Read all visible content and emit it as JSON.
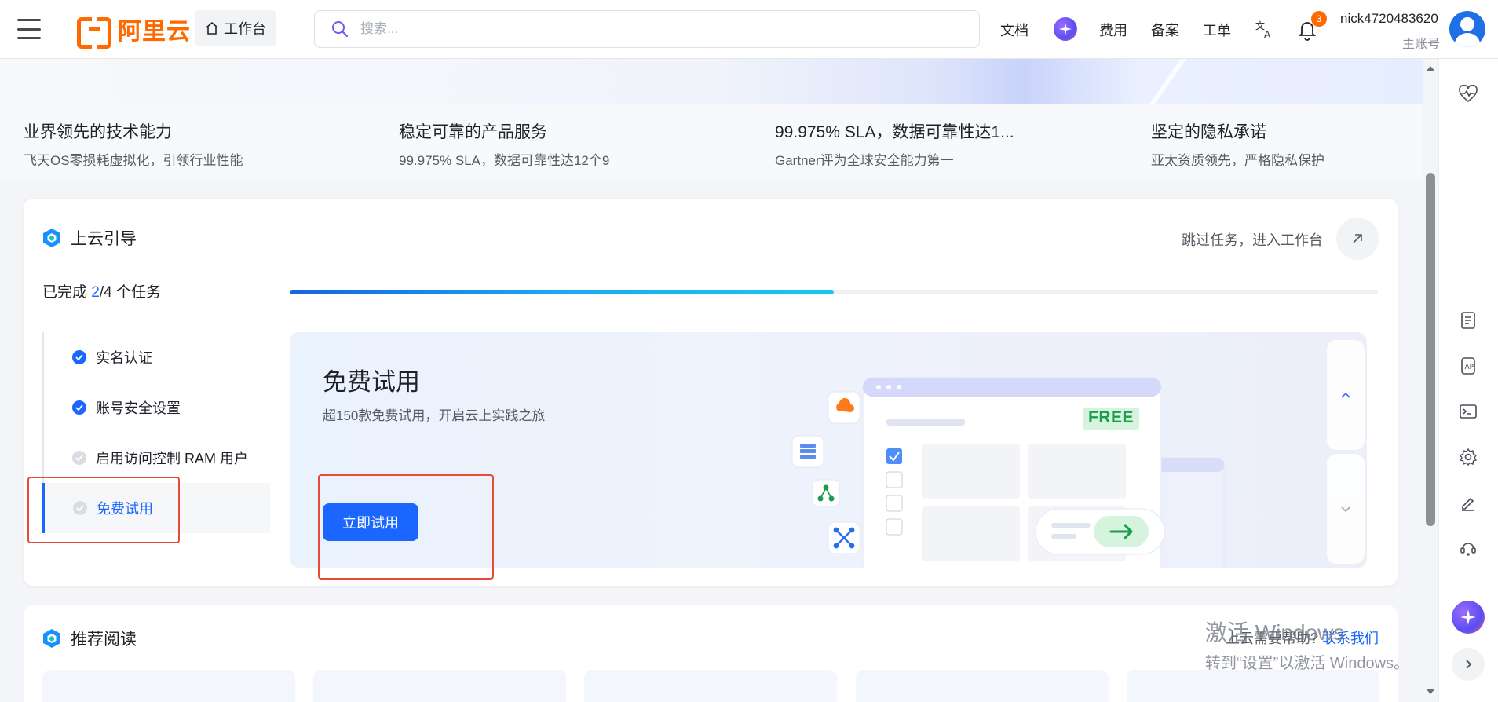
{
  "topbar": {
    "logo_text": "阿里云",
    "workbench_label": "工作台",
    "search_placeholder": "搜索...",
    "nav": {
      "docs": "文档",
      "billing": "费用",
      "icp": "备案",
      "ticket": "工单"
    },
    "notification_count": "3",
    "user_name": "nick4720483620",
    "user_role": "主账号"
  },
  "features": [
    {
      "title": "业界领先的技术能力",
      "desc": "飞天OS零损耗虚拟化，引领行业性能"
    },
    {
      "title": "稳定可靠的产品服务",
      "desc": "99.975% SLA，数据可靠性达12个9"
    },
    {
      "title": "99.975% SLA，数据可靠性达1...",
      "desc": "Gartner评为全球安全能力第一"
    },
    {
      "title": "坚定的隐私承诺",
      "desc": "亚太资质领先，严格隐私保护"
    }
  ],
  "guide": {
    "title": "上云引导",
    "skip_label": "跳过任务，进入工作台",
    "progress_prefix": "已完成 ",
    "progress_done": "2",
    "progress_suffix": "/4 个任务",
    "progress_fraction": 0.5,
    "steps": [
      {
        "label": "实名认证",
        "status": "done"
      },
      {
        "label": "账号安全设置",
        "status": "done"
      },
      {
        "label": "启用访问控制 RAM 用户",
        "status": "todo"
      },
      {
        "label": "免费试用",
        "status": "active"
      }
    ],
    "trial": {
      "title": "免费试用",
      "subtitle": "超150款免费试用，开启云上实践之旅",
      "button": "立即试用",
      "badge": "FREE"
    }
  },
  "reading": {
    "title": "推荐阅读",
    "help_prefix": "上云需要帮助?",
    "help_link": "联系我们"
  },
  "watermark": {
    "line1": "激活 Windows",
    "line2": "转到“设置”以激活 Windows。"
  },
  "colors": {
    "brand_orange": "#ff6a00",
    "primary_blue": "#1a66ff",
    "highlight_red": "#e64b36"
  }
}
